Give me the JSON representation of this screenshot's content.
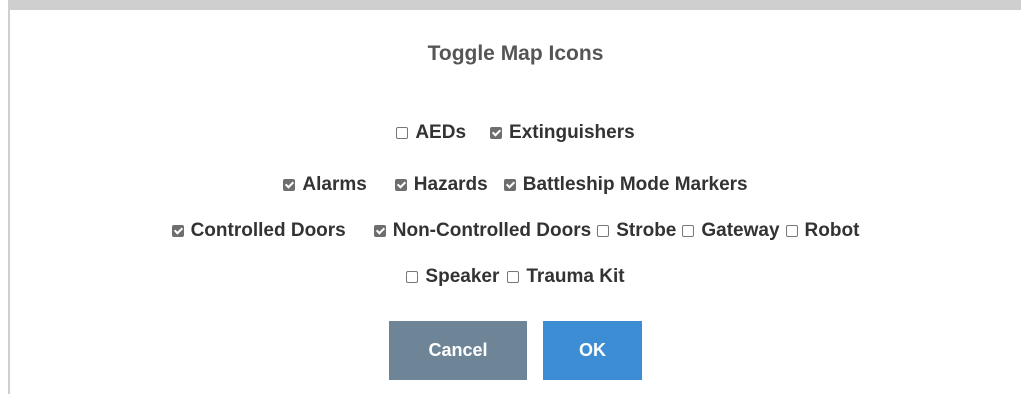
{
  "dialog": {
    "title": "Toggle Map Icons"
  },
  "options": [
    {
      "label": "AEDs",
      "checked": false
    },
    {
      "label": "Extinguishers",
      "checked": true
    },
    {
      "label": "Alarms",
      "checked": true
    },
    {
      "label": "Hazards",
      "checked": true
    },
    {
      "label": "Battleship Mode Markers",
      "checked": true
    },
    {
      "label": "Controlled Doors",
      "checked": true
    },
    {
      "label": "Non-Controlled Doors",
      "checked": true
    },
    {
      "label": "Strobe",
      "checked": false
    },
    {
      "label": "Gateway",
      "checked": false
    },
    {
      "label": "Robot",
      "checked": false
    },
    {
      "label": "Speaker",
      "checked": false
    },
    {
      "label": "Trauma Kit",
      "checked": false
    }
  ],
  "buttons": {
    "cancel_label": "Cancel",
    "ok_label": "OK"
  },
  "colors": {
    "cancel_button": "#6e8598",
    "ok_button": "#3d8dd4",
    "checked_box": "#6e6e6e"
  }
}
